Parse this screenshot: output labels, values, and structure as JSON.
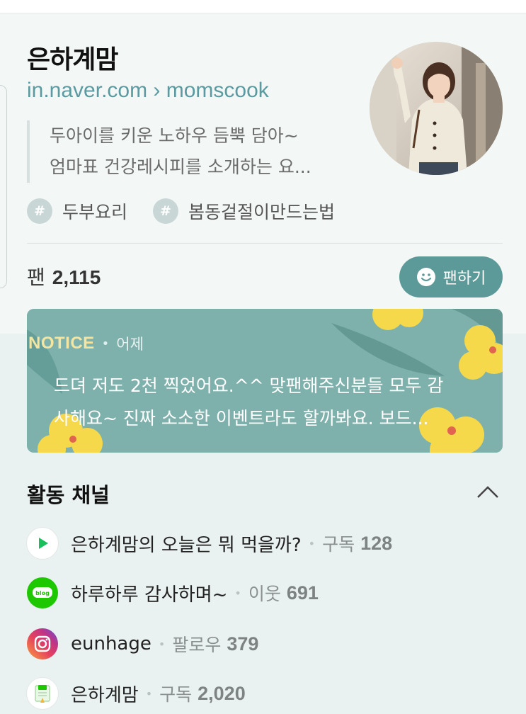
{
  "profile": {
    "name": "은하계맘",
    "url": "in.naver.com › momscook",
    "description_lines": [
      "두아이를 키운 노하우 듬뿍 담아~",
      "엄마표 건강레시피를 소개하는 요..."
    ],
    "tags": [
      "두부요리",
      "봄동겉절이만드는법"
    ],
    "fans_label": "팬",
    "fans_count": "2,115",
    "fan_button_label": "팬하기"
  },
  "notice": {
    "title": "NOTICE",
    "date": "어제",
    "lines": [
      "드뎌 저도 2천 찍었어요.^^ 맞팬해주신분들 모두 감",
      "사해요~ 진짜 소소한 이벤트라도 할까봐요. 보드..."
    ]
  },
  "channels_section": {
    "title": "활동 채널",
    "items": [
      {
        "icon": "play-icon",
        "name": "은하계맘의 오늘은 뭐 먹을까?",
        "metric": "구독",
        "count": "128"
      },
      {
        "icon": "blog-icon",
        "name": "하루하루 감사하며~",
        "metric": "이웃",
        "count": "691"
      },
      {
        "icon": "instagram-icon",
        "name": "eunhage",
        "metric": "팔로우",
        "count": "379"
      },
      {
        "icon": "post-icon",
        "name": "은하계맘",
        "metric": "구독",
        "count": "2,020"
      }
    ]
  },
  "colors": {
    "accent": "#5b9a98",
    "url": "#5b9aa0",
    "notice_bg": "#7fb1ac",
    "notice_title": "#f4e6a2"
  }
}
